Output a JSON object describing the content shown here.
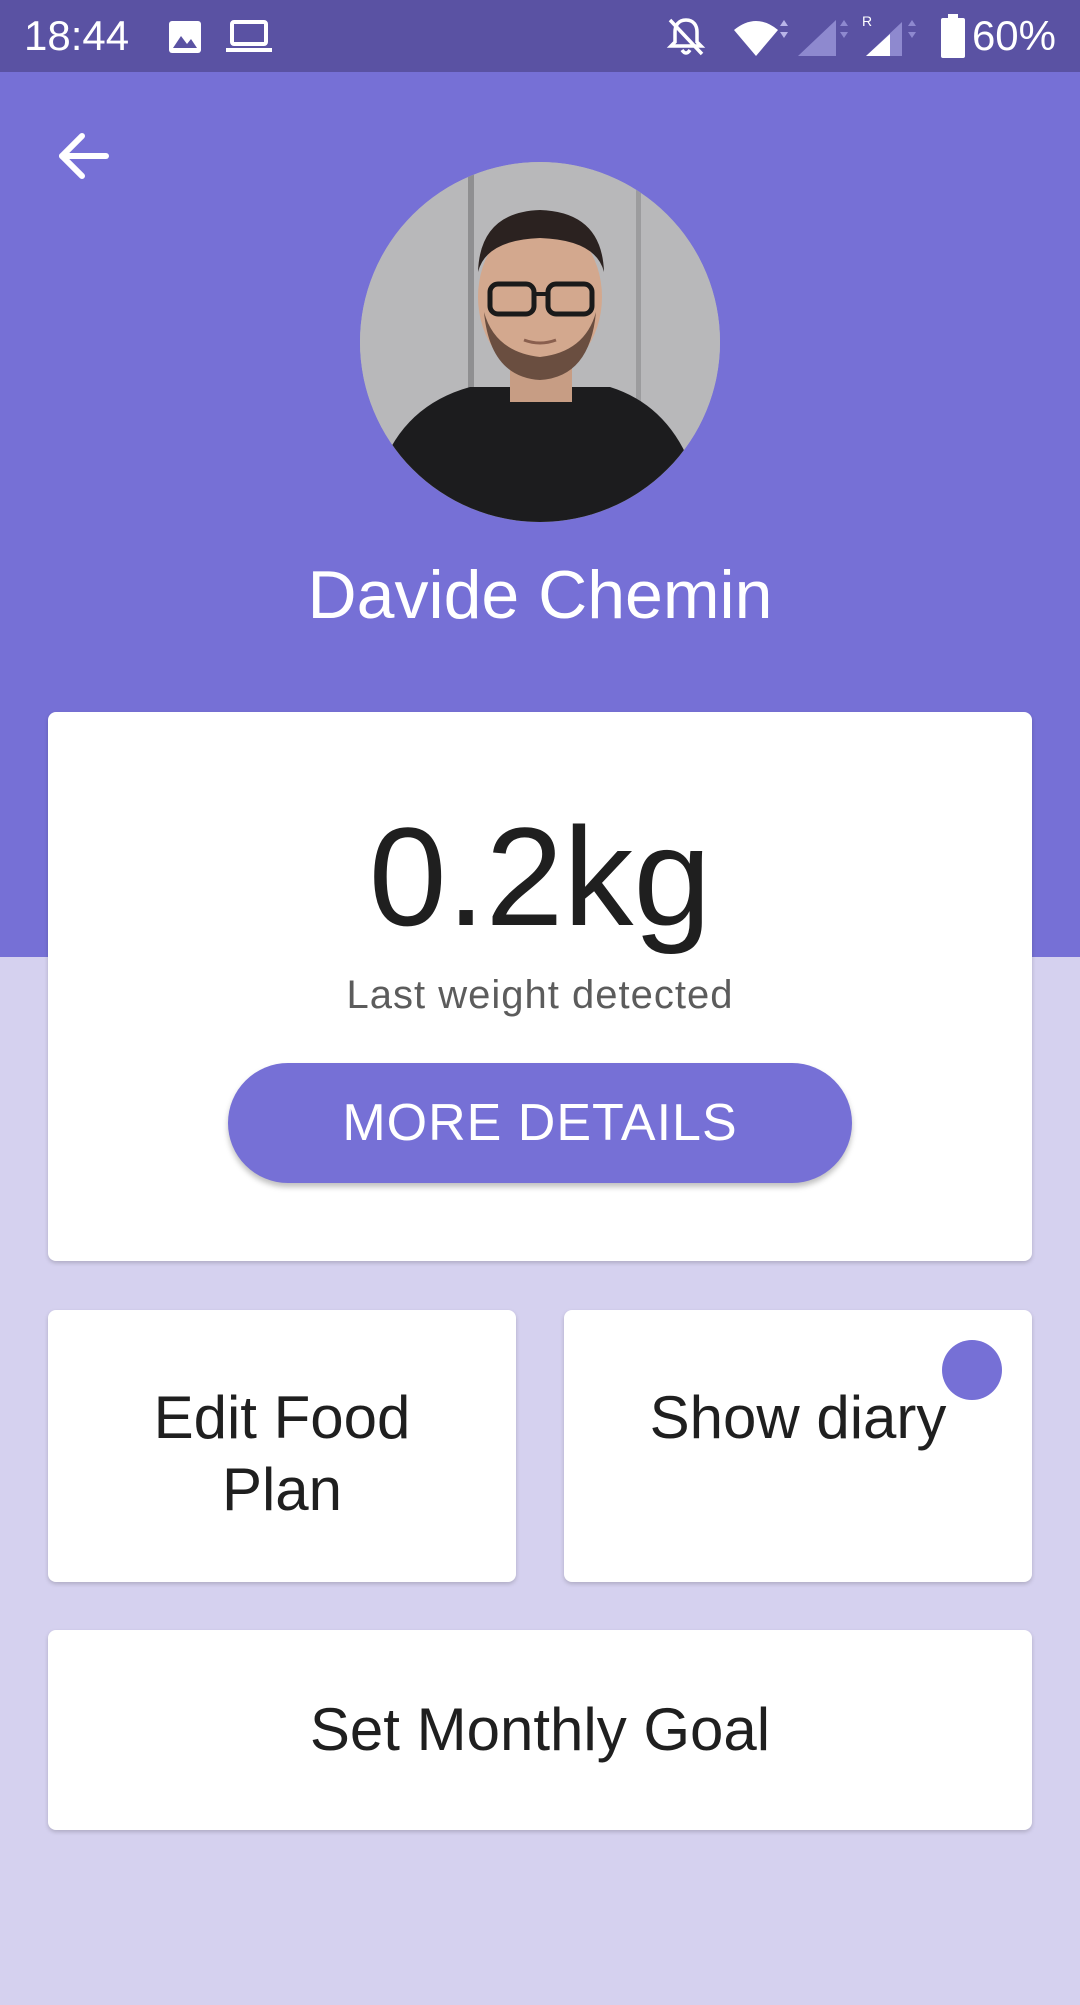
{
  "status_bar": {
    "time": "18:44",
    "battery_percent": "60%",
    "icons": [
      "image-icon",
      "laptop-icon",
      "notifications-off-icon",
      "wifi-icon",
      "signal-icon",
      "signal-roaming-icon",
      "battery-icon"
    ]
  },
  "header": {
    "back_icon": "arrow-left-icon",
    "background_color": "#7670d6"
  },
  "profile": {
    "name": "Davide Chemin"
  },
  "weight_card": {
    "value": "0.2kg",
    "caption": "Last weight detected",
    "button_label": "MORE DETAILS"
  },
  "tiles": {
    "food_plan_line1": "Edit Food",
    "food_plan_line2": "Plan",
    "diary": "Show diary",
    "monthly_goal": "Set Monthly Goal"
  },
  "colors": {
    "accent": "#7670d6",
    "status_bar": "#5a52a3",
    "page_background": "#d5d1ef"
  }
}
